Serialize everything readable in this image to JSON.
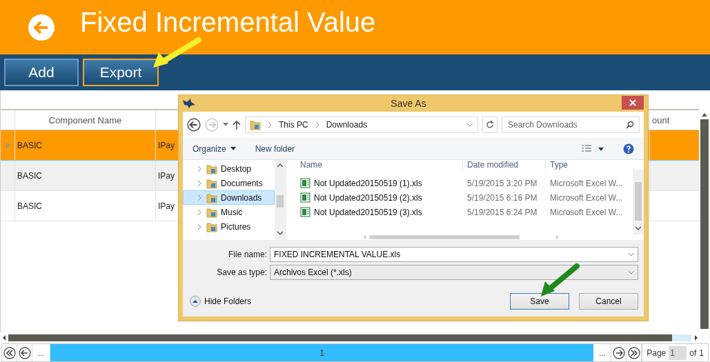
{
  "header": {
    "title": "Fixed Incremental Value"
  },
  "toolbar": {
    "buttons": [
      {
        "label": "Add",
        "selected": false
      },
      {
        "label": "Export",
        "selected": true
      }
    ]
  },
  "grid": {
    "columns": {
      "name": "Component Name",
      "column_4": "ount"
    },
    "rows": [
      {
        "name": "BASIC",
        "type": "IPay",
        "selected": true
      },
      {
        "name": "BASIC",
        "type": "IPay",
        "selected": false
      },
      {
        "name": "BASIC",
        "type": "IPay",
        "selected": false
      }
    ]
  },
  "pager": {
    "before": "...",
    "page_button": "1",
    "after": "...",
    "page_label": "Page",
    "page_value": "1",
    "of_label": "of",
    "total": "1"
  },
  "dialog": {
    "title": "Save As",
    "address": [
      "This PC",
      "Downloads"
    ],
    "search_placeholder": "Search Downloads",
    "organize": "Organize",
    "new_folder": "New folder",
    "nav_items": [
      {
        "label": "Desktop",
        "selected": false
      },
      {
        "label": "Documents",
        "selected": false
      },
      {
        "label": "Downloads",
        "selected": true
      },
      {
        "label": "Music",
        "selected": false
      },
      {
        "label": "Pictures",
        "selected": false
      }
    ],
    "columns": [
      "Name",
      "Date modified",
      "Type"
    ],
    "files": [
      {
        "name": "Not Updated20150519 (1).xls",
        "date": "5/19/2015 3:20 PM",
        "type": "Microsoft Excel W..."
      },
      {
        "name": "Not Updated20150519 (2).xls",
        "date": "5/19/2015 6:16 PM",
        "type": "Microsoft Excel W..."
      },
      {
        "name": "Not Updated20150519 (3).xls",
        "date": "5/19/2015 6:24 PM",
        "type": "Microsoft Excel W..."
      }
    ],
    "file_name_label": "File name:",
    "file_name": "FIXED INCREMENTAL VALUE.xls",
    "type_label": "Save as type:",
    "type_value": "Archivos Excel (*.xls)",
    "hide_folders": "Hide Folders",
    "buttons": [
      {
        "label": "Save",
        "selected": true
      },
      {
        "label": "Cancel",
        "selected": false
      }
    ]
  }
}
